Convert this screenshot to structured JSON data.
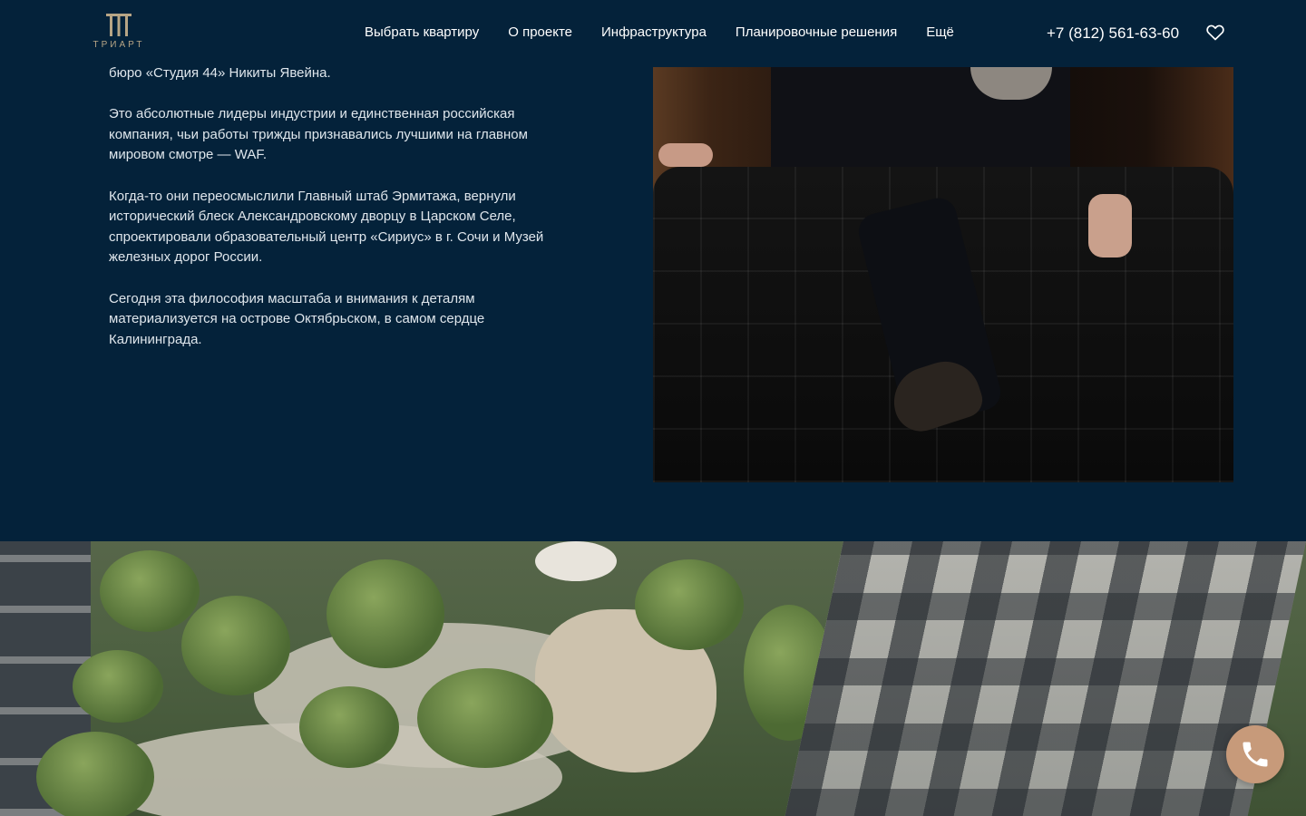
{
  "brand": {
    "name": "ТРИАРТ",
    "accent": "#b7a585"
  },
  "nav": {
    "items": [
      {
        "label": "Выбрать квартиру"
      },
      {
        "label": "О проекте"
      },
      {
        "label": "Инфраструктура"
      },
      {
        "label": "Планировочные решения"
      },
      {
        "label": "Ещё"
      }
    ]
  },
  "header": {
    "phone": "+7 (812) 561-63-60",
    "favorite_icon": "heart-icon"
  },
  "article": {
    "paragraphs": [
      "бюро «Студия 44» Никиты Явейна.",
      "Это абсолютные лидеры индустрии и единственная российская компания, чьи работы трижды признавались лучшими на главном мировом смотре — WAF.",
      "Когда-то они переосмыслили Главный штаб Эрмитажа, вернули исторический блеск Александровскому дворцу в Царском Селе, спроектировали образовательный центр «Сириус» в г. Сочи и Музей железных дорог России.",
      "Сегодня эта философия масштаба и внимания к деталям материализуется на острове Октябрьском, в самом сердце Калининграда."
    ]
  },
  "colors": {
    "background": "#04223a",
    "call_button": "#c79a7a"
  },
  "call_button": {
    "icon": "phone-icon"
  }
}
